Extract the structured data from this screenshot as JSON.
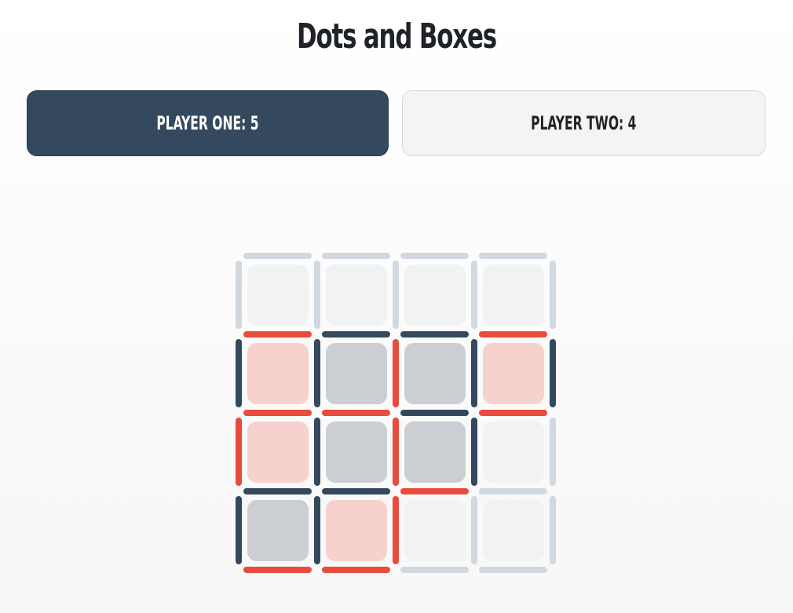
{
  "title": "Dots and Boxes",
  "players": {
    "one": {
      "label": "PLAYER ONE: 5",
      "color": "#34495e",
      "box_color": "#cbcfd3"
    },
    "two": {
      "label": "PLAYER TWO: 4",
      "color": "#e74c3c",
      "box_color": "#f6d1cd"
    }
  },
  "colors": {
    "empty_line": "#d1d8df",
    "empty_box": "#f1f2f4"
  },
  "board": {
    "rows": 4,
    "cols": 4,
    "horizontal_lines": [
      [
        "empty",
        "empty",
        "empty",
        "empty"
      ],
      [
        "two",
        "one",
        "one",
        "two"
      ],
      [
        "two",
        "two",
        "one",
        "two"
      ],
      [
        "one",
        "one",
        "two",
        "empty"
      ],
      [
        "two",
        "two",
        "empty",
        "empty"
      ]
    ],
    "vertical_lines": [
      [
        "empty",
        "empty",
        "empty",
        "empty",
        "empty"
      ],
      [
        "one",
        "one",
        "two",
        "one",
        "one"
      ],
      [
        "two",
        "one",
        "two",
        "one",
        "empty"
      ],
      [
        "one",
        "one",
        "two",
        "empty",
        "empty"
      ]
    ],
    "boxes": [
      [
        "empty",
        "empty",
        "empty",
        "empty"
      ],
      [
        "two",
        "one",
        "one",
        "two"
      ],
      [
        "two",
        "one",
        "one",
        "empty"
      ],
      [
        "one",
        "two",
        "empty",
        "empty"
      ]
    ]
  }
}
